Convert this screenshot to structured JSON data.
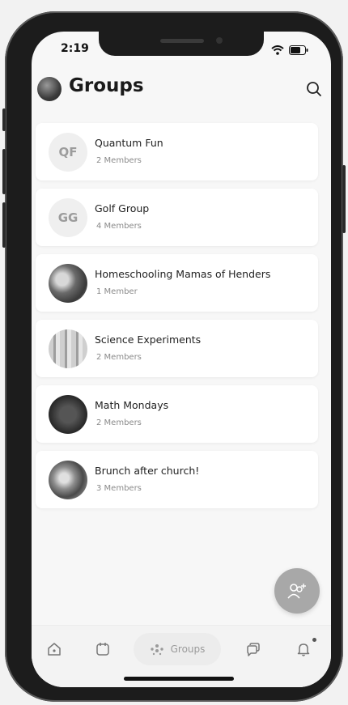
{
  "status_bar": {
    "time": "2:19"
  },
  "header": {
    "title": "Groups"
  },
  "groups": [
    {
      "initials": "QF",
      "name": "Quantum Fun",
      "members": "2 Members",
      "avatar": "initials"
    },
    {
      "initials": "GG",
      "name": "Golf Group",
      "members": "4 Members",
      "avatar": "initials"
    },
    {
      "initials": "",
      "name": "Homeschooling Mamas of Henders",
      "members": "1 Member",
      "avatar": "photo"
    },
    {
      "initials": "",
      "name": "Science Experiments",
      "members": "2 Members",
      "avatar": "photo"
    },
    {
      "initials": "",
      "name": "Math Mondays",
      "members": "2 Members",
      "avatar": "photo"
    },
    {
      "initials": "",
      "name": "Brunch after church!",
      "members": "3 Members",
      "avatar": "photo"
    }
  ],
  "tabbar": {
    "active_label": "Groups"
  },
  "colors": {
    "accent": "#a8a8a8",
    "background": "#f7f7f7",
    "card": "#ffffff"
  }
}
